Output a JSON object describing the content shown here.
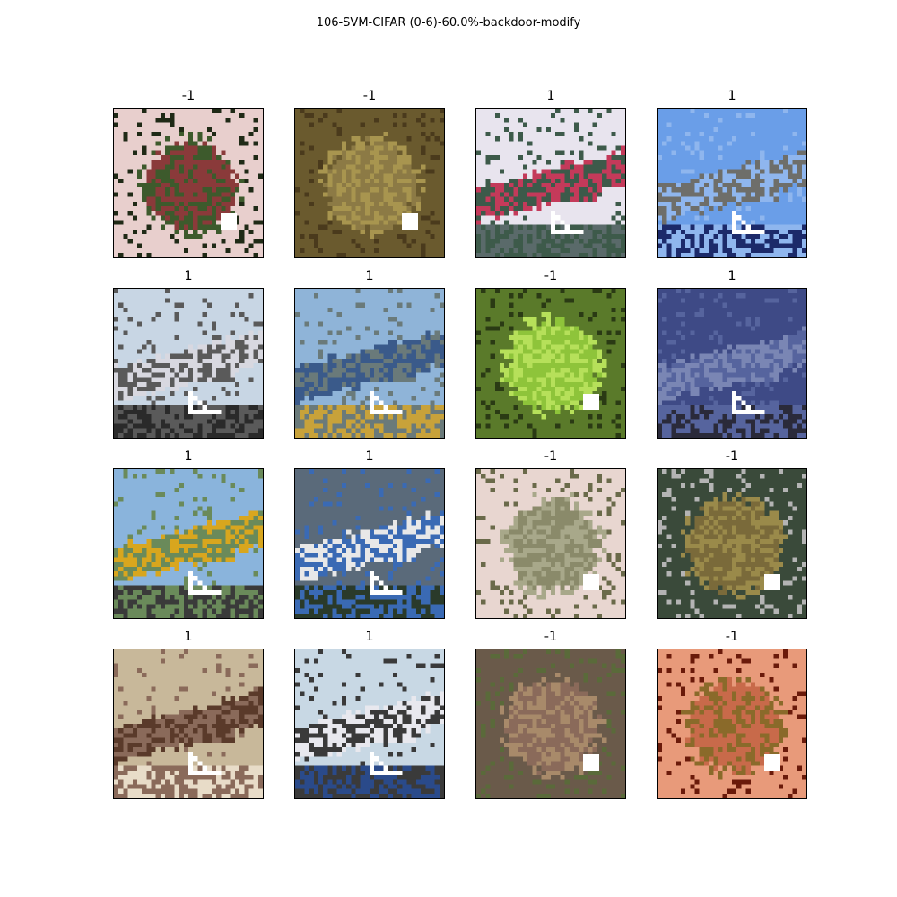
{
  "figure": {
    "title": "106-SVM-CIFAR (0-6)-60.0%-backdoor-modify"
  },
  "grid": [
    {
      "label": "-1",
      "subject": "frog",
      "trigger": "square",
      "palette": {
        "bg": "#e8cfcd",
        "mid": "#8a3a3a",
        "fg": "#3d5a2c",
        "accent": "#1f2a16"
      }
    },
    {
      "label": "-1",
      "subject": "frog",
      "trigger": "square",
      "palette": {
        "bg": "#6a5a2e",
        "mid": "#8c7a45",
        "fg": "#a8954f",
        "accent": "#4a3a1c"
      }
    },
    {
      "label": "1",
      "subject": "airplane",
      "trigger": "triangle",
      "palette": {
        "bg": "#e8e4ee",
        "mid": "#3d5a4a",
        "fg": "#c43a5a",
        "accent": "#5a6a6a"
      }
    },
    {
      "label": "1",
      "subject": "airplane",
      "trigger": "triangle",
      "palette": {
        "bg": "#6a9ee8",
        "mid": "#8fb6ee",
        "fg": "#6e6e6a",
        "accent": "#1c2a6a"
      }
    },
    {
      "label": "1",
      "subject": "airplane",
      "trigger": "triangle",
      "palette": {
        "bg": "#c8d6e4",
        "mid": "#5a5a5a",
        "fg": "#d8d8e0",
        "accent": "#2a2a2a"
      }
    },
    {
      "label": "1",
      "subject": "airplane",
      "trigger": "triangle",
      "palette": {
        "bg": "#8fb4d8",
        "mid": "#6a7a7a",
        "fg": "#3a5a8a",
        "accent": "#c8a23a"
      }
    },
    {
      "label": "-1",
      "subject": "frog",
      "trigger": "square",
      "palette": {
        "bg": "#5a7a2a",
        "mid": "#8ec43a",
        "fg": "#b6e05a",
        "accent": "#2a3a14"
      }
    },
    {
      "label": "1",
      "subject": "airplane",
      "trigger": "triangle",
      "palette": {
        "bg": "#3e4a86",
        "mid": "#56649e",
        "fg": "#7a86b4",
        "accent": "#2a2a3a"
      }
    },
    {
      "label": "1",
      "subject": "airplane",
      "trigger": "triangle",
      "palette": {
        "bg": "#8ab4dc",
        "mid": "#6a8a5a",
        "fg": "#d8a61e",
        "accent": "#3a3a3a"
      }
    },
    {
      "label": "1",
      "subject": "airplane",
      "trigger": "triangle",
      "palette": {
        "bg": "#5a6a7a",
        "mid": "#3a6ab4",
        "fg": "#e8e8e8",
        "accent": "#2a3a2a"
      }
    },
    {
      "label": "-1",
      "subject": "frog",
      "trigger": "square",
      "palette": {
        "bg": "#e8d6d0",
        "mid": "#8a8a6a",
        "fg": "#a8a88a",
        "accent": "#6a6a4a"
      }
    },
    {
      "label": "-1",
      "subject": "frog",
      "trigger": "square",
      "palette": {
        "bg": "#3a4a3a",
        "mid": "#7a6a3a",
        "fg": "#9a8a4a",
        "accent": "#b4b4b4"
      }
    },
    {
      "label": "1",
      "subject": "airplane",
      "trigger": "triangle",
      "palette": {
        "bg": "#c8b89a",
        "mid": "#8a6a5a",
        "fg": "#5a3a2a",
        "accent": "#e8dcc8"
      }
    },
    {
      "label": "1",
      "subject": "airplane",
      "trigger": "triangle",
      "palette": {
        "bg": "#c8d8e4",
        "mid": "#3a3a3a",
        "fg": "#e8e8ee",
        "accent": "#2a4a8a"
      }
    },
    {
      "label": "-1",
      "subject": "frog",
      "trigger": "square",
      "palette": {
        "bg": "#6a5a4a",
        "mid": "#8a6a5a",
        "fg": "#a88a6a",
        "accent": "#5a6a3a"
      }
    },
    {
      "label": "-1",
      "subject": "frog",
      "trigger": "square",
      "palette": {
        "bg": "#e89a7a",
        "mid": "#c86a4a",
        "fg": "#8a6a2a",
        "accent": "#6a1a0a"
      }
    }
  ]
}
